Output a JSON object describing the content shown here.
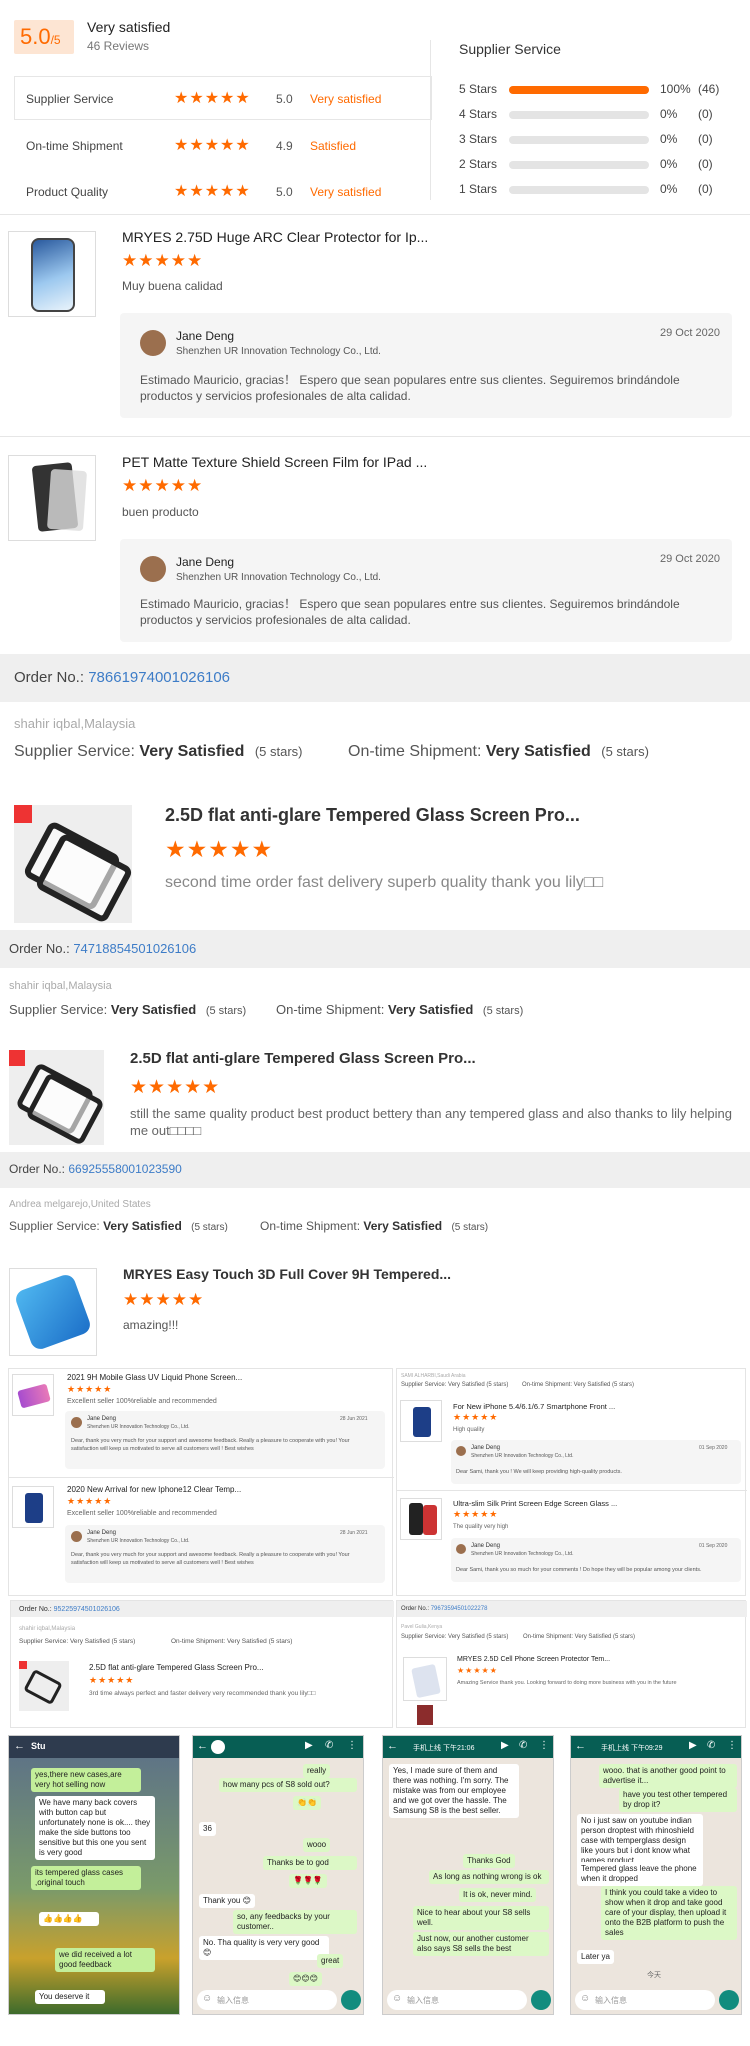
{
  "summary": {
    "score": "5.0",
    "score_suffix": "/5",
    "verdict": "Very satisfied",
    "reviews": "46 Reviews",
    "rows": [
      {
        "label": "Supplier Service",
        "stars": 5,
        "value": "5.0",
        "verdict": "Very satisfied"
      },
      {
        "label": "On-time Shipment",
        "stars": 5,
        "value": "4.9",
        "verdict": "Satisfied"
      },
      {
        "label": "Product Quality",
        "stars": 5,
        "value": "5.0",
        "verdict": "Very satisfied"
      }
    ],
    "distribution_title": "Supplier Service",
    "distribution": [
      {
        "label": "5 Stars",
        "pct_value": 100,
        "pct": "100%",
        "count": "(46)"
      },
      {
        "label": "4 Stars",
        "pct_value": 0,
        "pct": "0%",
        "count": "(0)"
      },
      {
        "label": "3 Stars",
        "pct_value": 0,
        "pct": "0%",
        "count": "(0)"
      },
      {
        "label": "2 Stars",
        "pct_value": 0,
        "pct": "0%",
        "count": "(0)"
      },
      {
        "label": "1 Stars",
        "pct_value": 0,
        "pct": "0%",
        "count": "(0)"
      }
    ]
  },
  "reviews": [
    {
      "product": "MRYES 2.75D Huge ARC Clear Protector for Ip...",
      "stars": "★★★★★",
      "comment": "Muy buena calidad",
      "reply_name": "Jane Deng",
      "reply_company": "Shenzhen UR Innovation Technology Co., Ltd.",
      "reply_date": "29 Oct 2020",
      "reply_text": "Estimado Mauricio, gracias！ Espero que sean populares entre sus clientes. Seguiremos brindándole productos y servicios profesionales de alta calidad."
    },
    {
      "product": "PET Matte Texture Shield Screen Film for IPad ...",
      "stars": "★★★★★",
      "comment": "buen producto",
      "reply_name": "Jane Deng",
      "reply_company": "Shenzhen UR Innovation Technology Co., Ltd.",
      "reply_date": "29 Oct 2020",
      "reply_text": "Estimado Mauricio, gracias！ Espero que sean populares entre sus clientes. Seguiremos brindándole productos y servicios profesionales de alta calidad."
    }
  ],
  "order1": {
    "label": "Order No.:",
    "number": "78661974001026106",
    "buyer": "shahir iqbal,Malaysia",
    "supplier_label": "Supplier Service:",
    "supplier_value": "Very Satisfied",
    "supplier_stars": "(5 stars)",
    "shipment_label": "On-time Shipment:",
    "shipment_value": "Very Satisfied",
    "shipment_stars": "(5 stars)",
    "product": "2.5D flat anti-glare Tempered Glass Screen Pro...",
    "stars": "★★★★★",
    "comment": "second time order fast delivery superb quality thank you lily□□"
  },
  "order2": {
    "label": "Order No.:",
    "number": "74718854501026106",
    "buyer": "shahir iqbal,Malaysia",
    "supplier_label": "Supplier Service:",
    "supplier_value": "Very Satisfied",
    "supplier_stars": "(5 stars)",
    "shipment_label": "On-time Shipment:",
    "shipment_value": "Very Satisfied",
    "shipment_stars": "(5 stars)",
    "product": "2.5D flat anti-glare Tempered Glass Screen Pro...",
    "stars": "★★★★★",
    "comment": "still the same quality product best product bettery than any tempered glass and also thanks to lily helping me out□□□□"
  },
  "order3": {
    "label": "Order No.:",
    "number": "66925558001023590",
    "buyer": "Andrea melgarejo,United States",
    "supplier_label": "Supplier Service:",
    "supplier_value": "Very Satisfied",
    "supplier_stars": "(5 stars)",
    "shipment_label": "On-time Shipment:",
    "shipment_value": "Very Satisfied",
    "shipment_stars": "(5 stars)",
    "product": "MRYES Easy Touch 3D Full Cover 9H Tempered...",
    "stars": "★★★★★",
    "comment": "amazing!!!"
  },
  "collage": {
    "left": [
      {
        "product": "2021 9H Mobile Glass UV Liquid Phone Screen...",
        "stars": "★★★★★",
        "comment": "Excellent seller 100%reliable and recommended",
        "reply_name": "Jane Deng",
        "reply_company": "Shenzhen UR Innovation Technology Co., Ltd.",
        "reply_date": "28 Jun 2021",
        "reply_text": "Dear, thank you very much for your support and awesome feedback. Really a pleasure to cooperate with you! Your satisfaction will keep us motivated to serve all customers well ! Best wishes"
      },
      {
        "product": "2020 New Arrival for new Iphone12 Clear Temp...",
        "stars": "★★★★★",
        "comment": "Excellent seller 100%reliable and recommended",
        "reply_name": "Jane Deng",
        "reply_company": "Shenzhen UR Innovation Technology Co., Ltd.",
        "reply_date": "28 Jun 2021",
        "reply_text": "Dear, thank you very much for your support and awesome feedback. Really a pleasure to cooperate with you! Your satisfaction will keep us motivated to serve all customers well ! Best wishes"
      }
    ],
    "right": [
      {
        "product": "For New iPhone 5.4/6.1/6.7 Smartphone Front ...",
        "stars": "★★★★★",
        "comment": "High quality",
        "reply_name": "Jane Deng",
        "reply_company": "Shenzhen UR Innovation Technology Co., Ltd.",
        "reply_date": "01 Sep 2020",
        "reply_text": "Dear Sami, thank you ! We will keep providing high-quality products."
      },
      {
        "product": "Ultra-slim Silk Print Screen Edge Screen Glass ...",
        "stars": "★★★★★",
        "comment": "The quality very high",
        "reply_name": "Jane Deng",
        "reply_company": "Shenzhen UR Innovation Technology Co., Ltd.",
        "reply_date": "01 Sep 2020",
        "reply_text": "Dear Sami, thank you so much for your comments ! Do hope they will be popular among your clients."
      }
    ],
    "right_buyer": "SAMI ALHARBI,Saudi Arabia",
    "right_supplier": "Supplier Service: Very Satisfied",
    "right_supplier_stars": "(5 stars)",
    "right_shipment": "On-time Shipment: Very Satisfied",
    "right_shipment_stars": "(5 stars)",
    "order_left": {
      "label": "Order No.:",
      "number": "95225974501026106",
      "buyer": "shahir iqbal,Malaysia",
      "supplier": "Supplier Service: Very Satisfied",
      "supplier_stars": "(5 stars)",
      "shipment": "On-time Shipment: Very Satisfied",
      "shipment_stars": "(5 stars)",
      "product": "2.5D flat anti-glare Tempered Glass Screen Pro...",
      "stars": "★★★★★",
      "comment": "3rd time always perfect and faster delivery very recommended thank you lily□□"
    },
    "order_right": {
      "label": "Order No.:",
      "number": "79673594501022278",
      "buyer": "Pavel Gulia,Kenya",
      "supplier": "Supplier Service: Very Satisfied",
      "supplier_stars": "(5 stars)",
      "shipment": "On-time Shipment: Very Satisfied",
      "shipment_stars": "(5 stars)",
      "product": "MRYES 2.5D Cell Phone Screen Protector Tem...",
      "stars": "★★★★★",
      "comment": "Amazing Service thank you. Looking forward to doing more business with you in the future"
    }
  },
  "chats": {
    "p1": {
      "header": "Stu",
      "msgs": [
        "yes,there new cases,are very hot selling now",
        "We have many back covers with button cap but unfortunately none is ok.... they make the side buttons too sensitive but this one you sent is very good",
        "its tempered glass cases ,original touch",
        "👍👍👍👍",
        "we did received a lot good feedback",
        "You deserve it"
      ]
    },
    "p2": {
      "msgs": [
        "really",
        "how many pcs of S8 sold out?",
        "👏👏",
        "36",
        "wooo",
        "Thanks be to god",
        "🌹🌹🌹",
        "Thank you 😊",
        "so, any feedbacks by your customer..",
        "No. Tha quality is very very good 😊",
        "great",
        "😊😊😊"
      ],
      "input": "输入信息"
    },
    "p3": {
      "time": "手机上线 下午21:06",
      "msgs": [
        "Yes, I made sure of them and there was nothing. I'm sorry. The mistake was from our employee and we got over the hassle. The Samsung S8 is the best seller.",
        "Thanks God",
        "As long as nothing wrong is ok",
        "It is ok, never mind.",
        "Nice to hear about your S8 sells well.",
        "Just now, our another customer also says S8 sells  the best"
      ],
      "input": "输入信息"
    },
    "p4": {
      "time": "手机上线 下午09:29",
      "msgs": [
        "wooo. that is another good point to advertise it...",
        "have you test other tempered by drop it?",
        "No i just saw on youtube indian person droptest with rhinoshield case with temperglass design like yours but i dont know what names product",
        "Tempered glass leave the phone when it dropped",
        "I think you could take a video to show when it drop and take good care of your display, then upload it onto the B2B platform to push the sales",
        "Later ya",
        "今天"
      ],
      "input": "输入信息"
    }
  },
  "colors": {
    "accent": "#ff6a00",
    "link": "#3d7cc7",
    "chat_green": "#dcf8c6",
    "chat_header": "#075e54"
  }
}
